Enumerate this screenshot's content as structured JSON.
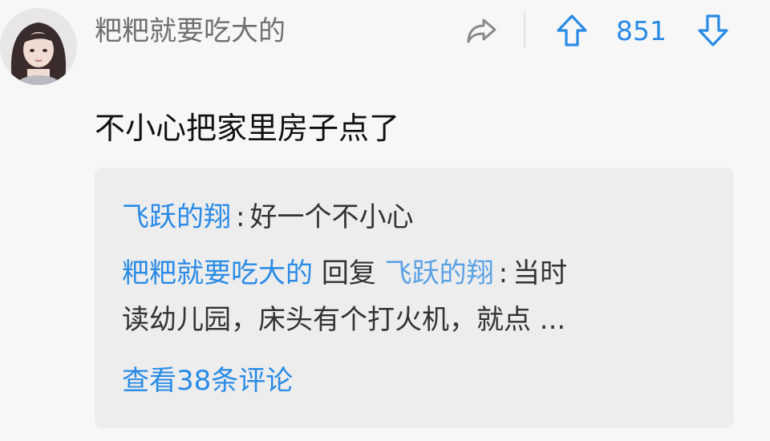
{
  "post": {
    "author": "粑粑就要吃大的",
    "votes": "851",
    "text": "不小心把家里房子点了"
  },
  "icons": {
    "share": "share-icon",
    "upvote": "arrow-up-icon",
    "downvote": "arrow-down-icon"
  },
  "comments": {
    "first": {
      "author": "飞跃的翔",
      "separator": ":",
      "text": "好一个不小心"
    },
    "reply": {
      "author": "粑粑就要吃大的",
      "action": "回复",
      "target": "飞跃的翔",
      "separator": ":",
      "text_line1": "当时",
      "text_line2": "读幼儿园，床头有个打火机，就点 ..."
    },
    "view_all": "查看38条评论"
  },
  "colors": {
    "accent": "#2a8be6",
    "background": "#f7f7f7",
    "comment_box": "#ededed"
  }
}
